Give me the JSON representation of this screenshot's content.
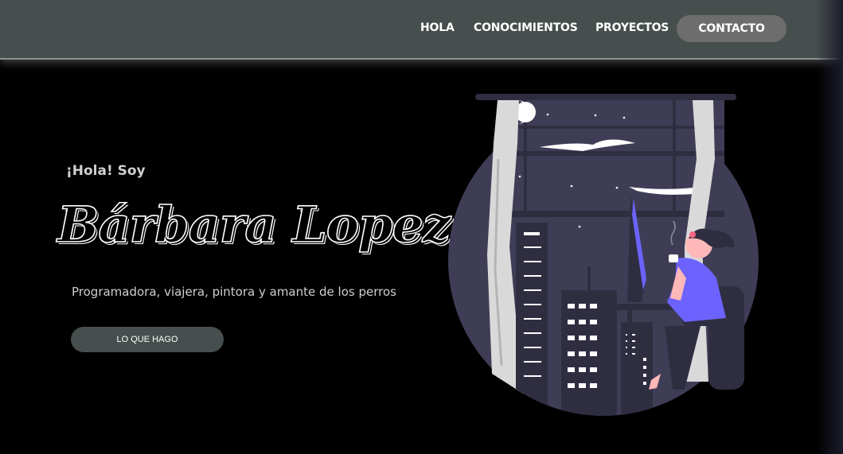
{
  "nav": {
    "items": [
      "HOLA",
      "CONOCIMIENTOS",
      "PROYECTOS"
    ],
    "contact_label": "CONTACTO"
  },
  "hero": {
    "greeting": "¡Hola! Soy",
    "name": "Bárbara Lopez",
    "tagline": "Programadora, viajera, pintora y amante de los perros",
    "cta_label": "LO QUE HAGO"
  },
  "illustration": {
    "subject": "woman-working-at-computer-by-window-at-night",
    "colors": {
      "circle": "#3f3d56",
      "accent": "#6c63ff",
      "curtain": "#d9d9d9",
      "frame": "#2f2e41",
      "window_light": "#ffffff"
    }
  },
  "colors": {
    "background": "#000000",
    "navbar": "#474f4e",
    "contact_button": "#6d6d6d",
    "cta_button": "#474f4e",
    "text_light": "#cfcfcf"
  }
}
